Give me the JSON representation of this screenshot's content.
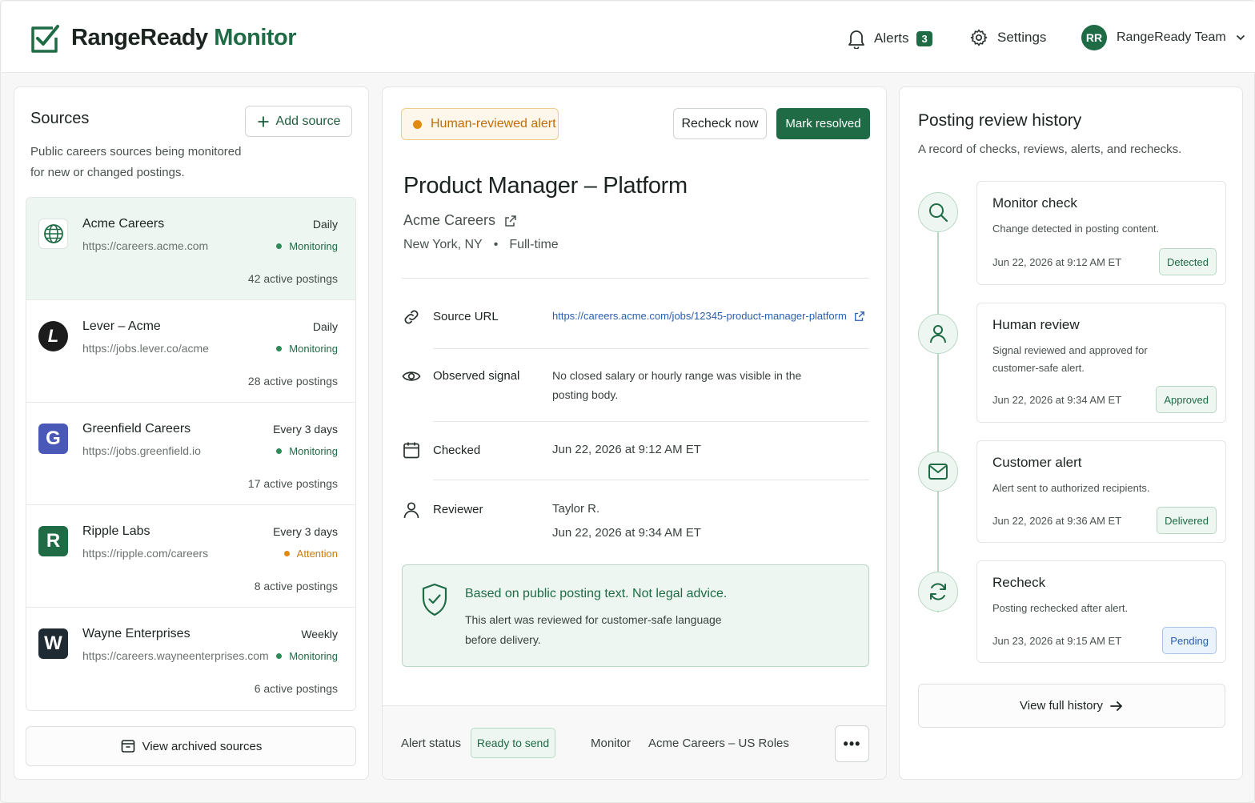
{
  "app": {
    "name": "RangeReady",
    "name_accent": "Monitor"
  },
  "header": {
    "alerts_label": "Alerts",
    "alerts_count": "3",
    "settings_label": "Settings",
    "user_initials": "RR",
    "user_name": "RangeReady Team"
  },
  "sources": {
    "title": "Sources",
    "description": "Public careers sources being monitored for new or changed postings.",
    "add_label": "Add source",
    "archived_label": "View archived sources",
    "items": [
      {
        "name": "Acme Careers",
        "url": "https://careers.acme.com",
        "frequency": "Daily",
        "status": "Monitoring",
        "count": "42 active postings",
        "logo": "globe-icon"
      },
      {
        "name": "Lever – Acme",
        "url": "https://jobs.lever.co/acme",
        "frequency": "Daily",
        "status": "Monitoring",
        "count": "28 active postings",
        "logo": "lever-logo",
        "logo_letter": "L"
      },
      {
        "name": "Greenfield Careers",
        "url": "https://jobs.greenfield.io",
        "frequency": "Every 3 days",
        "status": "Monitoring",
        "count": "17 active postings",
        "logo": "greenfield-logo",
        "logo_letter": "G"
      },
      {
        "name": "Ripple Labs",
        "url": "https://ripple.com/careers",
        "frequency": "Every 3 days",
        "status": "Attention",
        "count": "8 active postings",
        "logo": "ripple-logo",
        "logo_letter": "R"
      },
      {
        "name": "Wayne Enterprises",
        "url": "https://careers.wayneenterprises.com",
        "frequency": "Weekly",
        "status": "Monitoring",
        "count": "6 active postings",
        "logo": "wayne-logo",
        "logo_letter": "W"
      }
    ]
  },
  "detail": {
    "alert_pill": "Human-reviewed alert",
    "recheck_label": "Recheck now",
    "resolve_label": "Mark resolved",
    "job_title": "Product Manager – Platform",
    "company": "Acme Careers",
    "location": "New York, NY",
    "separator": "•",
    "employment": "Full-time",
    "rows": {
      "source_url_label": "Source URL",
      "source_url_value": "https://careers.acme.com/jobs/12345-product-manager-platform",
      "signal_label": "Observed signal",
      "signal_value": "No closed salary or hourly range was visible in the posting body.",
      "checked_label": "Checked",
      "checked_value": "Jun 22, 2026 at 9:12 AM ET",
      "reviewer_label": "Reviewer",
      "reviewer_name": "Taylor R.",
      "reviewer_time": "Jun 22, 2026 at 9:34 AM ET"
    },
    "notice_title": "Based on public posting text. Not legal advice.",
    "notice_body": "This alert was reviewed for customer-safe language before delivery.",
    "footer": {
      "status_label": "Alert status",
      "status_value": "Ready to send",
      "monitor_label": "Monitor",
      "monitor_value": "Acme Careers – US Roles",
      "more_label": "•••"
    }
  },
  "history": {
    "title": "Posting review history",
    "description": "A record of checks, reviews, alerts, and rechecks.",
    "events": [
      {
        "title": "Monitor check",
        "body": "Change detected in posting content.",
        "time": "Jun 22, 2026 at 9:12 AM ET",
        "badge": "Detected",
        "icon": "search-icon"
      },
      {
        "title": "Human review",
        "body": "Signal reviewed and approved for customer-safe alert.",
        "time": "Jun 22, 2026 at 9:34 AM ET",
        "badge": "Approved",
        "icon": "user-icon"
      },
      {
        "title": "Customer alert",
        "body": "Alert sent to authorized recipients.",
        "time": "Jun 22, 2026 at 9:36 AM ET",
        "badge": "Delivered",
        "icon": "mail-icon"
      },
      {
        "title": "Recheck",
        "body": "Posting rechecked after alert.",
        "time": "Jun 23, 2026 at 9:15 AM ET",
        "badge": "Pending",
        "icon": "refresh-icon"
      }
    ],
    "view_full_label": "View full history"
  },
  "colors": {
    "brand": "#1e6b45",
    "warning": "#e08a12",
    "link": "#2b5fb0"
  }
}
